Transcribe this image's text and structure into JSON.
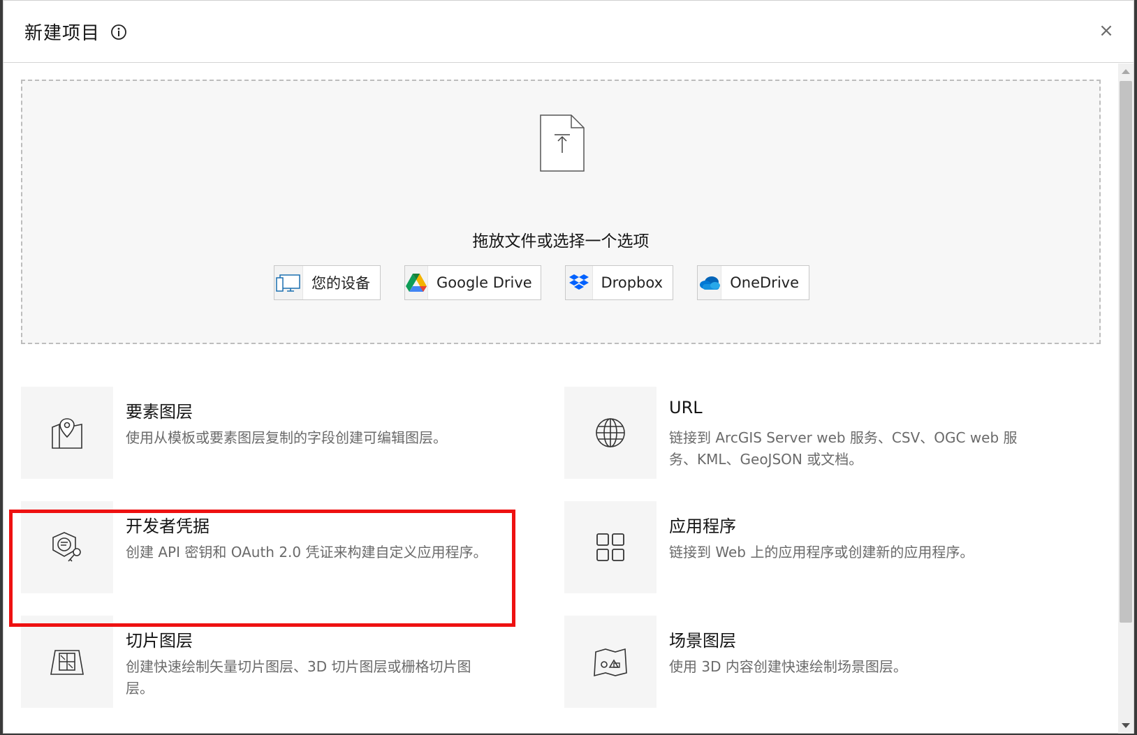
{
  "header": {
    "title": "新建项目",
    "close_label": "×"
  },
  "dropzone": {
    "text": "拖放文件或选择一个选项"
  },
  "sources": [
    {
      "label": "您的设备",
      "icon": "device-icon"
    },
    {
      "label": "Google Drive",
      "icon": "google-drive-icon"
    },
    {
      "label": "Dropbox",
      "icon": "dropbox-icon"
    },
    {
      "label": "OneDrive",
      "icon": "onedrive-icon"
    }
  ],
  "cards": [
    {
      "title": "要素图层",
      "desc": "使用从模板或要素图层复制的字段创建可编辑图层。",
      "icon": "map-pin-icon"
    },
    {
      "title": "URL",
      "desc": "链接到 ArcGIS Server web 服务、CSV、OGC web 服务、KML、GeoJSON 或文档。",
      "icon": "globe-icon"
    },
    {
      "title": "开发者凭据",
      "desc": "创建 API 密钥和 OAuth 2.0 凭证来构建自定义应用程序。",
      "icon": "credentials-icon"
    },
    {
      "title": "应用程序",
      "desc": "链接到 Web 上的应用程序或创建新的应用程序。",
      "icon": "apps-grid-icon"
    },
    {
      "title": "切片图层",
      "desc": "创建快速绘制矢量切片图层、3D 切片图层或栅格切片图层。",
      "icon": "tile-layer-icon"
    },
    {
      "title": "场景图层",
      "desc": "使用 3D 内容创建快速绘制场景图层。",
      "icon": "scene-layer-icon"
    }
  ],
  "colors": {
    "highlight": "#ee1111",
    "text": "#151515",
    "muted": "#6a6a6a"
  }
}
